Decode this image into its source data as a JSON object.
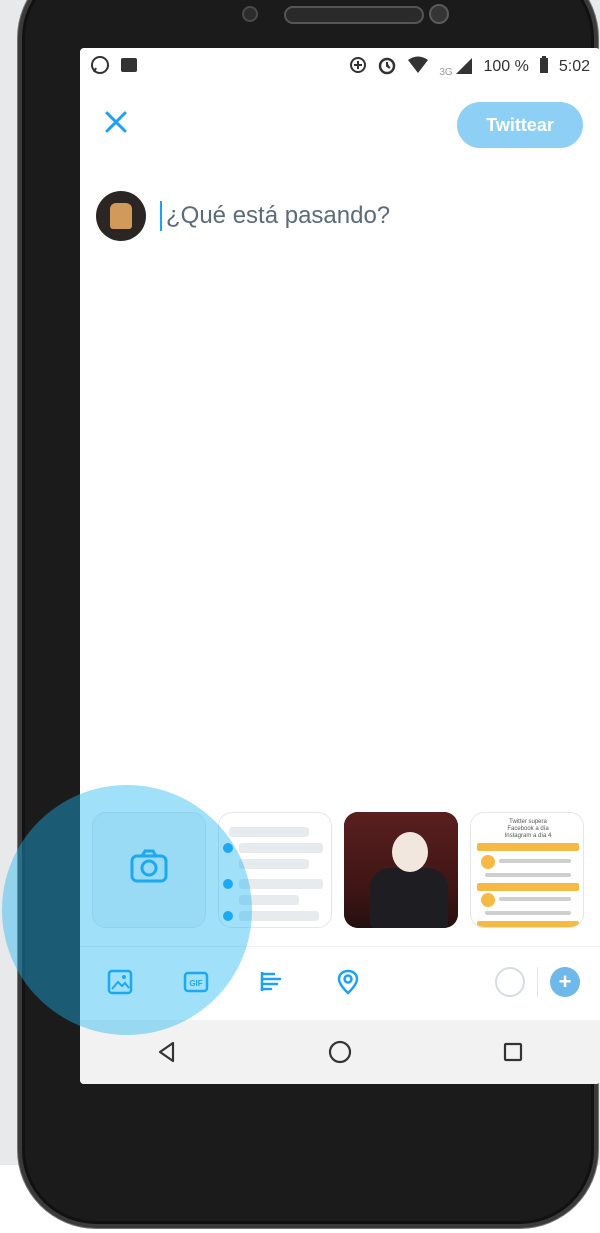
{
  "status_bar": {
    "left_icons": [
      "whatsapp-icon",
      "gallery-icon"
    ],
    "right_icons": [
      "data-saver-icon",
      "alarm-icon",
      "wifi-icon",
      "signal-icon"
    ],
    "network": "3G",
    "battery": "100 %",
    "time": "5:02"
  },
  "compose": {
    "tweet_button": "Twittear",
    "placeholder": "¿Qué está pasando?"
  },
  "media_strip": {
    "items": [
      "camera",
      "screenshot-list",
      "portrait-photo",
      "infographic"
    ]
  },
  "infographic_thumb": {
    "title_lines": [
      "Twitter supera",
      "Facebook a día",
      "Instagram a día 4"
    ]
  },
  "tool_bar": {
    "icons": [
      "image-icon",
      "gif-icon",
      "poll-icon",
      "location-icon"
    ],
    "gif_label": "GIF"
  },
  "colors": {
    "accent": "#1da1f2",
    "tweet_button_bg": "#8ecff5",
    "touch_indicator": "#1db5f1"
  }
}
